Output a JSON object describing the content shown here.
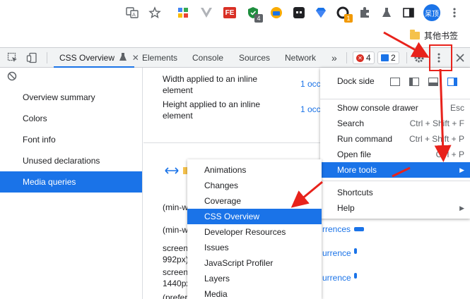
{
  "chrome": {
    "avatar_label": "呆顶",
    "ext_badges": {
      "ext_a": "4",
      "ext_b": "1"
    },
    "bookmark_folder": "其他书签"
  },
  "devtools": {
    "tabs": [
      {
        "label": "CSS Overview",
        "active": true
      },
      {
        "label": "Elements",
        "active": false
      },
      {
        "label": "Console",
        "active": false
      },
      {
        "label": "Sources",
        "active": false
      },
      {
        "label": "Network",
        "active": false
      }
    ],
    "more_tabs": "»",
    "errors_count": "4",
    "messages_count": "2"
  },
  "sidebar": {
    "items": [
      {
        "label": "Overview summary",
        "active": false
      },
      {
        "label": "Colors",
        "active": false
      },
      {
        "label": "Font info",
        "active": false
      },
      {
        "label": "Unused declarations",
        "active": false
      },
      {
        "label": "Media queries",
        "active": true
      }
    ]
  },
  "main": {
    "rows": [
      {
        "label_line1": "Width applied to an inline",
        "label_line2": "element",
        "link": "1 occ"
      },
      {
        "label_line1": "Height applied to an inline",
        "label_line2": "element",
        "link": "1 occ"
      }
    ],
    "media_rows": [
      {
        "text1": "(min-w",
        "text2": "",
        "link": "",
        "bar_fraction": 0
      },
      {
        "text1": "(min-w",
        "text2": "",
        "link": "rrences",
        "bar_fraction": 1.0
      },
      {
        "text1": "screen",
        "text2": "992px)",
        "link": "urrence",
        "bar_fraction": 0.3
      },
      {
        "text1": "screen",
        "text2": "1440px",
        "link": "urrence",
        "bar_fraction": 0.3
      },
      {
        "text1": "(prefer",
        "text2": "",
        "link": "",
        "bar_fraction": 0
      }
    ]
  },
  "menu": {
    "dock_side_label": "Dock side",
    "items": [
      {
        "label": "Show console drawer",
        "shortcut": "Esc",
        "active": false
      },
      {
        "label": "Search",
        "shortcut": "Ctrl + Shift + F",
        "active": false
      },
      {
        "label": "Run command",
        "shortcut": "Ctrl + Shift + P",
        "active": false
      },
      {
        "label": "Open file",
        "shortcut": "Ctrl + P",
        "active": false
      },
      {
        "label": "More tools",
        "shortcut": "▶",
        "active": true
      },
      {
        "label": "Shortcuts",
        "shortcut": "",
        "active": false
      },
      {
        "label": "Help",
        "shortcut": "▶",
        "active": false
      }
    ]
  },
  "submenu": {
    "items": [
      {
        "label": "Animations",
        "active": false
      },
      {
        "label": "Changes",
        "active": false
      },
      {
        "label": "Coverage",
        "active": false
      },
      {
        "label": "CSS Overview",
        "active": true
      },
      {
        "label": "Developer Resources",
        "active": false
      },
      {
        "label": "Issues",
        "active": false
      },
      {
        "label": "JavaScript Profiler",
        "active": false
      },
      {
        "label": "Layers",
        "active": false
      },
      {
        "label": "Media",
        "active": false
      }
    ]
  },
  "colors": {
    "accent": "#1a73e8",
    "annotation": "#e8221b"
  }
}
